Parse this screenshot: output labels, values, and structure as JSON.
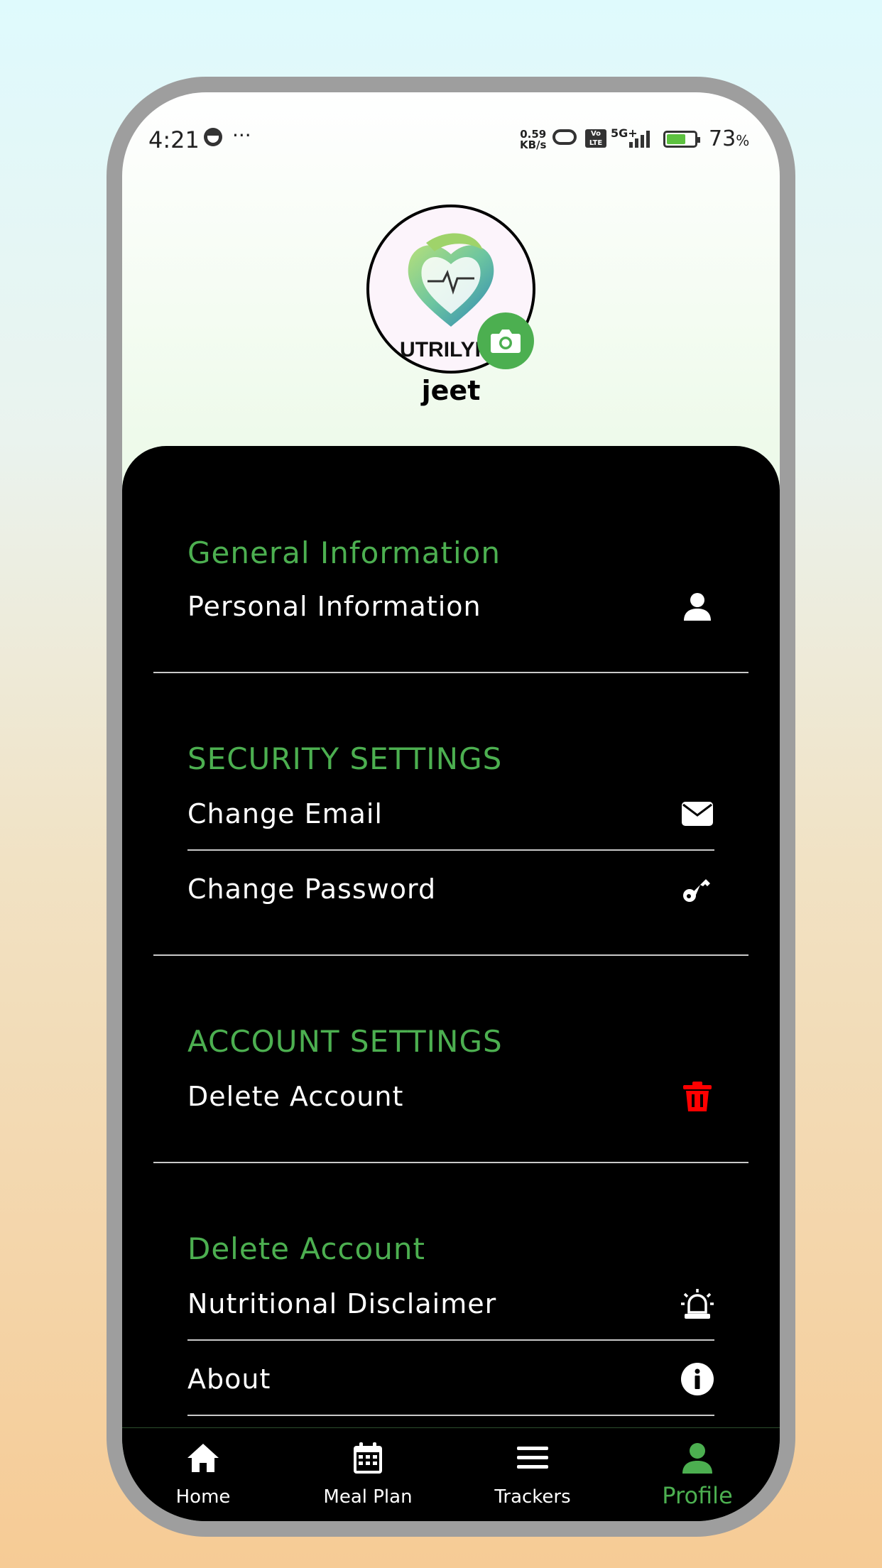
{
  "status_bar": {
    "time": "4:21",
    "dots": "···",
    "speed_value": "0.59",
    "speed_unit": "KB/s",
    "volte": "Vo LTE",
    "network": "5G+",
    "battery_percent": "73",
    "battery_unit": "%"
  },
  "profile": {
    "logo_text": "UTRILYFE",
    "username": "jeet",
    "camera_icon": "camera-icon"
  },
  "sections": {
    "general": {
      "title": "General Information",
      "items": [
        {
          "label": "Personal Information",
          "icon": "user-icon"
        }
      ]
    },
    "security": {
      "title": "SECURITY SETTINGS",
      "items": [
        {
          "label": "Change Email",
          "icon": "envelope-icon"
        },
        {
          "label": "Change Password",
          "icon": "key-icon"
        }
      ]
    },
    "account": {
      "title": "ACCOUNT SETTINGS",
      "items": [
        {
          "label": "Delete Account",
          "icon": "trash-icon",
          "icon_color": "#ff0000"
        }
      ]
    },
    "other": {
      "title": "Delete Account",
      "items": [
        {
          "label": "Nutritional Disclaimer",
          "icon": "alarm-icon"
        },
        {
          "label": "About",
          "icon": "info-icon"
        }
      ]
    }
  },
  "bottom_nav": [
    {
      "label": "Home",
      "icon": "home-icon",
      "active": false
    },
    {
      "label": "Meal Plan",
      "icon": "calendar-icon",
      "active": false
    },
    {
      "label": "Trackers",
      "icon": "menu-icon",
      "active": false
    },
    {
      "label": "Profile",
      "icon": "user-icon",
      "active": true
    }
  ],
  "colors": {
    "accent": "#4caf50",
    "panel": "#000000",
    "danger": "#ff0000",
    "frame": "#9e9e9e"
  }
}
